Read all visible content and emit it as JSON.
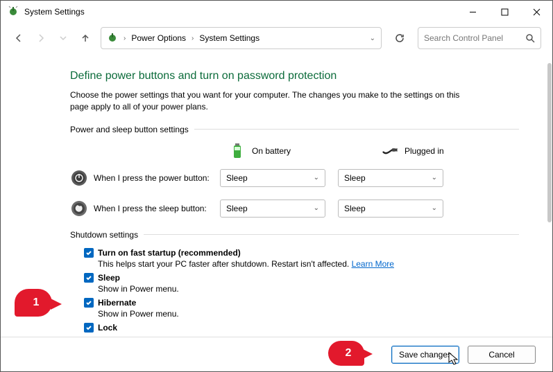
{
  "window": {
    "title": "System Settings"
  },
  "breadcrumb": {
    "level1": "Power Options",
    "level2": "System Settings"
  },
  "search": {
    "placeholder": "Search Control Panel"
  },
  "page": {
    "heading": "Define power buttons and turn on password protection",
    "description": "Choose the power settings that you want for your computer. The changes you make to the settings on this page apply to all of your power plans."
  },
  "power_sleep": {
    "group_label": "Power and sleep button settings",
    "col_battery": "On battery",
    "col_plugged": "Plugged in",
    "rows": [
      {
        "label": "When I press the power button:",
        "battery": "Sleep",
        "plugged": "Sleep"
      },
      {
        "label": "When I press the sleep button:",
        "battery": "Sleep",
        "plugged": "Sleep"
      }
    ]
  },
  "shutdown": {
    "group_label": "Shutdown settings",
    "items": [
      {
        "label": "Turn on fast startup (recommended)",
        "desc_prefix": "This helps start your PC faster after shutdown. Restart isn't affected. ",
        "learn_more": "Learn More",
        "checked": true
      },
      {
        "label": "Sleep",
        "desc": "Show in Power menu.",
        "checked": true
      },
      {
        "label": "Hibernate",
        "desc": "Show in Power menu.",
        "checked": true
      },
      {
        "label": "Lock",
        "checked": true
      }
    ]
  },
  "footer": {
    "save": "Save changes",
    "cancel": "Cancel"
  },
  "callouts": {
    "one": "1",
    "two": "2"
  }
}
